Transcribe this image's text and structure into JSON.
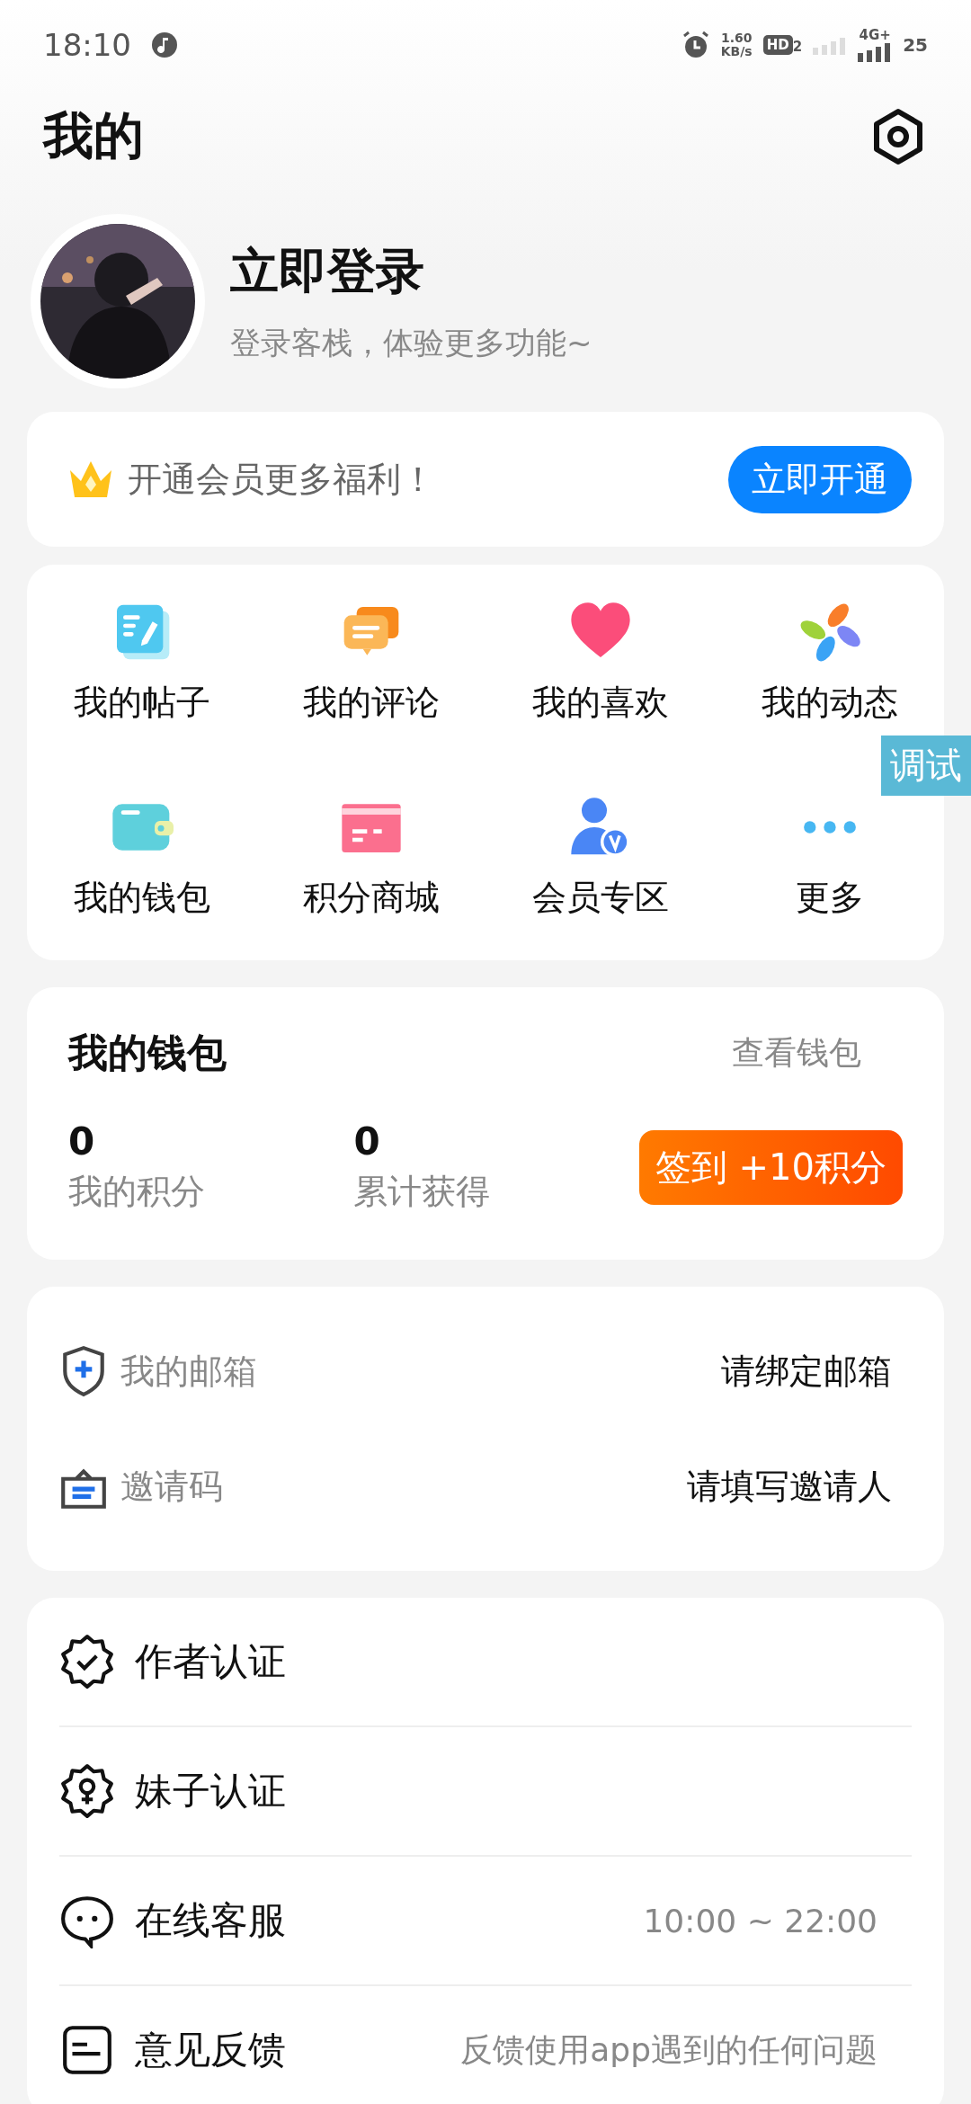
{
  "status_bar": {
    "time": "18:10",
    "speed_value": "1.60",
    "speed_unit": "KB/s",
    "hd_label": "HD",
    "hd_sim": "2",
    "network_type": "4G+",
    "battery": "25"
  },
  "header": {
    "title": "我的"
  },
  "profile": {
    "name": "立即登录",
    "subtitle": "登录客栈，体验更多功能~"
  },
  "vip_banner": {
    "text": "开通会员更多福利！",
    "button": "立即开通"
  },
  "shortcuts": [
    {
      "kind": "posts",
      "label": "我的帖子"
    },
    {
      "kind": "comments",
      "label": "我的评论"
    },
    {
      "kind": "likes",
      "label": "我的喜欢"
    },
    {
      "kind": "moments",
      "label": "我的动态"
    },
    {
      "kind": "wallet",
      "label": "我的钱包"
    },
    {
      "kind": "mall",
      "label": "积分商城"
    },
    {
      "kind": "vip",
      "label": "会员专区"
    },
    {
      "kind": "more",
      "label": "更多"
    }
  ],
  "debug_tag": "调试",
  "wallet": {
    "title": "我的钱包",
    "link": "查看钱包",
    "stats": [
      {
        "value": "0",
        "label": "我的积分"
      },
      {
        "value": "0",
        "label": "累计获得"
      }
    ],
    "checkin_button": "签到 +10积分"
  },
  "account": [
    {
      "kind": "email",
      "label": "我的邮箱",
      "action": "请绑定邮箱"
    },
    {
      "kind": "invite",
      "label": "邀请码",
      "action": "请填写邀请人"
    }
  ],
  "services": [
    {
      "kind": "author",
      "label": "作者认证"
    },
    {
      "kind": "female",
      "label": "妹子认证"
    },
    {
      "kind": "support",
      "label": "在线客服",
      "detail": "10:00 ~ 22:00"
    },
    {
      "kind": "feedback",
      "label": "意见反馈",
      "detail": "反馈使用app遇到的任何问题"
    }
  ]
}
